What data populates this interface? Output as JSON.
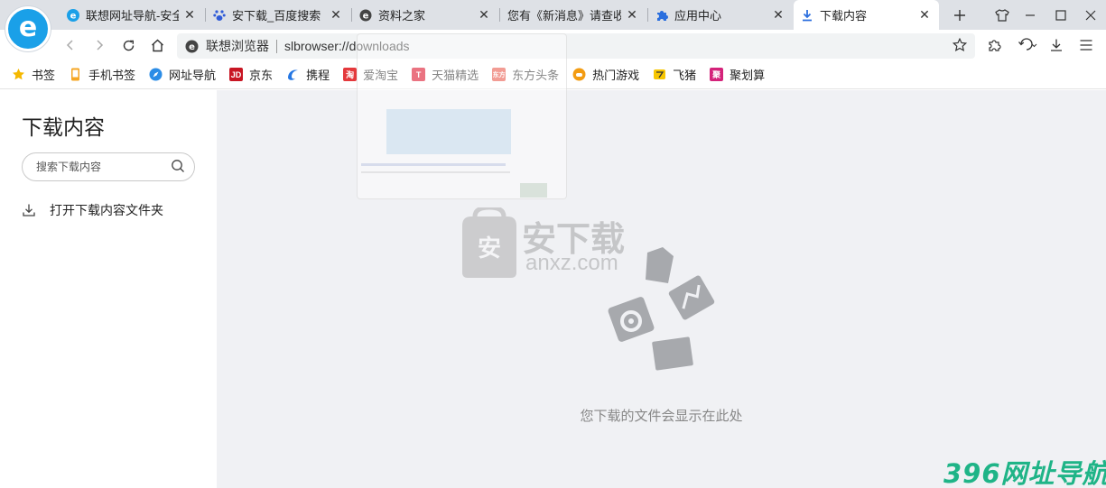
{
  "tabs": [
    {
      "title": "联想网址导航-安全",
      "icon": "lenovo-e-icon"
    },
    {
      "title": "安下载_百度搜索",
      "icon": "baidu-paw-icon"
    },
    {
      "title": "资料之家",
      "icon": "site-e-icon"
    },
    {
      "title": "您有《新消息》请查收",
      "icon": "none"
    },
    {
      "title": "应用中心",
      "icon": "puzzle-icon"
    },
    {
      "title": "下载内容",
      "icon": "download-icon"
    }
  ],
  "toolbar": {
    "site_name": "联想浏览器",
    "url": "slbrowser://downloads"
  },
  "bookmarks": [
    {
      "label": "书签",
      "icon": "star-icon",
      "color": "#f5b800"
    },
    {
      "label": "手机书签",
      "icon": "phone-icon",
      "color": "#f5a623"
    },
    {
      "label": "网址导航",
      "icon": "nav-icon",
      "color": "#2b8ce6"
    },
    {
      "label": "京东",
      "icon": "jd-icon",
      "color": "#c81623",
      "glyph": "JD"
    },
    {
      "label": "携程",
      "icon": "ctrip-icon",
      "color": "#2577e3"
    },
    {
      "label": "爱淘宝",
      "icon": "taobao-icon",
      "color": "#e4393c",
      "glyph": "淘"
    },
    {
      "label": "天猫精选",
      "icon": "tmall-icon",
      "color": "#d9001b",
      "glyph": "T"
    },
    {
      "label": "东方头条",
      "icon": "dftt-icon",
      "color": "#e84c3d",
      "glyph": "东方"
    },
    {
      "label": "热门游戏",
      "icon": "game-icon",
      "color": "#f39c12"
    },
    {
      "label": "飞猪",
      "icon": "fliggy-icon",
      "color": "#f7c600"
    },
    {
      "label": "聚划算",
      "icon": "juhuasuan-icon",
      "color": "#d4237a",
      "glyph": "聚"
    }
  ],
  "sidebar": {
    "title": "下载内容",
    "search_placeholder": "搜索下载内容",
    "open_folder": "打开下载内容文件夹"
  },
  "content": {
    "empty_text": "您下载的文件会显示在此处"
  },
  "watermarks": {
    "anxz_cn": "安下载",
    "anxz_url": "anxz.com",
    "site396": "396网址导航"
  },
  "colors": {
    "accent": "#1aa0e8",
    "tab_bg": "#dee1e6",
    "content_bg": "#f0f1f4"
  }
}
